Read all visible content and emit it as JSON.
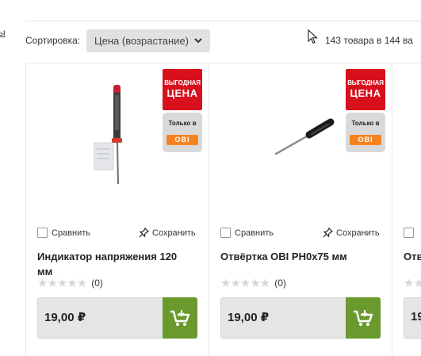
{
  "left_cut_text": "ы",
  "toolbar": {
    "sort_label": "Сортировка:",
    "sort_value": "Цена (возрастание)",
    "count_text": "143 товара в 144 ва"
  },
  "badges": {
    "price_line1": "ВЫГОДНАЯ",
    "price_line2": "ЦЕНА",
    "obi_line1": "Только в",
    "obi_logo": "OBI"
  },
  "products": [
    {
      "compare_label": "Сравнить",
      "save_label": "Сохранить",
      "title_line1": "Индикатор напряжения 120",
      "title_line2": "мм",
      "rating_count": "(0)",
      "price": "19,00 ₽"
    },
    {
      "compare_label": "Сравнить",
      "save_label": "Сохранить",
      "title_line1": "Отвёртка OBI PH0x75 мм",
      "title_line2": "",
      "rating_count": "(0)",
      "price": "19,00 ₽"
    },
    {
      "compare_label": "",
      "save_label": "",
      "title_line1": "Отв",
      "title_line2": "",
      "rating_count": "",
      "price": "19"
    }
  ],
  "colors": {
    "badge_red": "#d8101c",
    "cart_green": "#6a9a2e",
    "obi_orange": "#f58220"
  }
}
